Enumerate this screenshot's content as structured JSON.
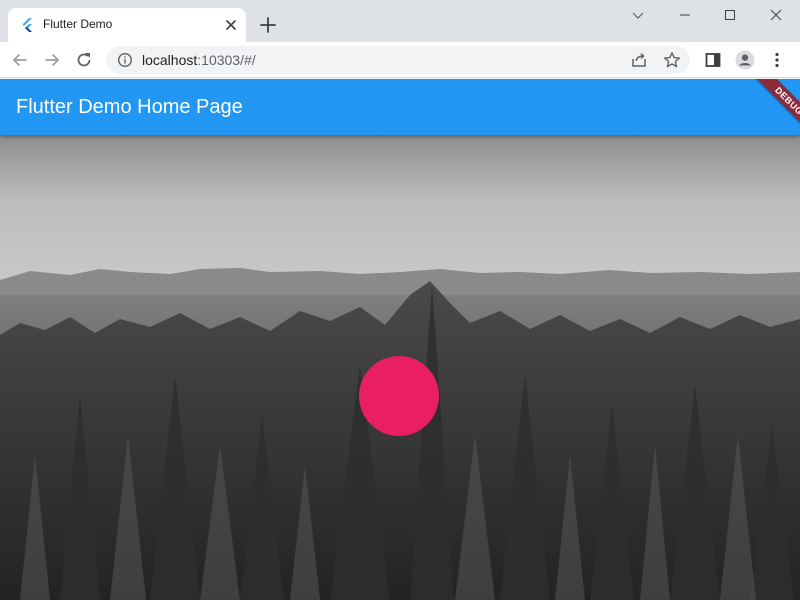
{
  "browser": {
    "tab": {
      "title": "Flutter Demo",
      "favicon": "flutter-logo-icon"
    },
    "new_tab_icon": "plus-icon",
    "window_controls": [
      "chevron-down-icon",
      "minimize-icon",
      "maximize-icon",
      "close-icon"
    ],
    "toolbar": {
      "back_icon": "arrow-left-icon",
      "forward_icon": "arrow-right-icon",
      "reload_icon": "reload-icon",
      "site_info_icon": "info-icon",
      "url_host": "localhost",
      "url_rest": ":10303/#/",
      "share_icon": "share-icon",
      "bookmark_icon": "star-icon",
      "side_panel_icon": "side-panel-icon",
      "profile_icon": "profile-icon",
      "menu_icon": "kebab-menu-icon"
    }
  },
  "app": {
    "appbar_title": "Flutter Demo Home Page",
    "debug_banner": "DEBUG",
    "colors": {
      "primary": "#2196f3",
      "accent_circle": "#e91e63",
      "debug_banner": "#8c2a3c"
    },
    "background": "grayscale-forest-and-mountains-photo"
  }
}
